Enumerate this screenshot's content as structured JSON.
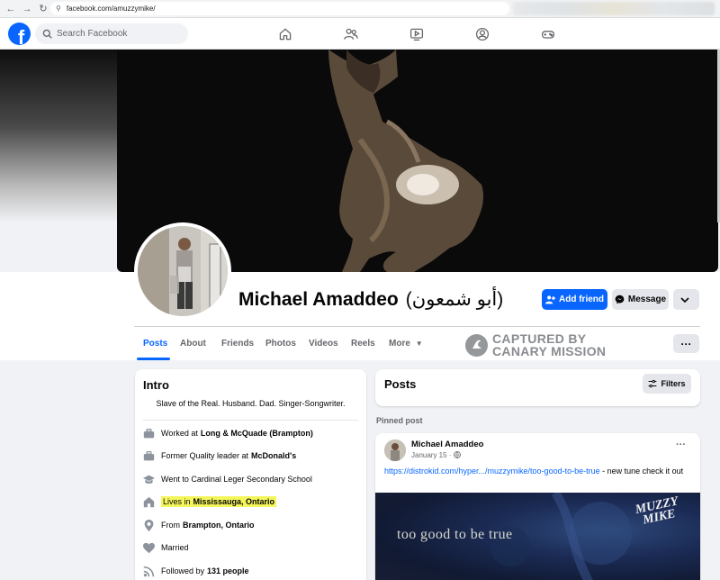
{
  "browser": {
    "url": "facebook.com/amuzzymike/"
  },
  "header": {
    "logo": "f",
    "search_placeholder": "Search Facebook",
    "nav_icons": [
      "home-icon",
      "friends-icon",
      "video-icon",
      "groups-icon",
      "gaming-icon"
    ]
  },
  "profile": {
    "name": "Michael Amaddeo",
    "alt_name": "(أبو شمعون)",
    "add_friend_label": "Add friend",
    "message_label": "Message"
  },
  "tabs": [
    {
      "label": "Posts",
      "active": true
    },
    {
      "label": "About"
    },
    {
      "label": "Friends"
    },
    {
      "label": "Photos"
    },
    {
      "label": "Videos"
    },
    {
      "label": "Reels"
    },
    {
      "label": "More"
    }
  ],
  "watermark": {
    "line1": "CAPTURED BY",
    "line2": "CANARY MISSION"
  },
  "intro": {
    "title": "Intro",
    "bio": "Slave of the Real. Husband. Dad. Singer-Songwriter.",
    "rows": [
      {
        "icon": "work-icon",
        "prefix": "Worked at",
        "bold": "Long & McQuade (Brampton)"
      },
      {
        "icon": "work-icon",
        "prefix": "Former Quality leader at",
        "bold": "McDonald's"
      },
      {
        "icon": "school-icon",
        "prefix": "Went to Cardinal Leger Secondary School",
        "bold": ""
      },
      {
        "icon": "home-icon",
        "prefix": "Lives in",
        "bold": "Mississauga, Ontario",
        "highlighted": true
      },
      {
        "icon": "location-icon",
        "prefix": "From",
        "bold": "Brampton, Ontario"
      },
      {
        "icon": "heart-icon",
        "prefix": "Married",
        "bold": ""
      },
      {
        "icon": "rss-icon",
        "prefix": "Followed by",
        "bold": "131 people"
      }
    ]
  },
  "posts": {
    "title": "Posts",
    "filters_label": "Filters",
    "pinned_label": "Pinned post",
    "pinned": {
      "author": "Michael Amaddeo",
      "date": "January 15 ·",
      "link": "https://distrokid.com/hyper.../muzzymike/too-good-to-be-true",
      "text": " - new tune check it out",
      "image_title": "too good to be true",
      "image_brand_line1": "MUZZY",
      "image_brand_line2": "MIKE"
    }
  },
  "colors": {
    "fb_blue": "#0866ff",
    "highlight": "#f4f65c"
  }
}
